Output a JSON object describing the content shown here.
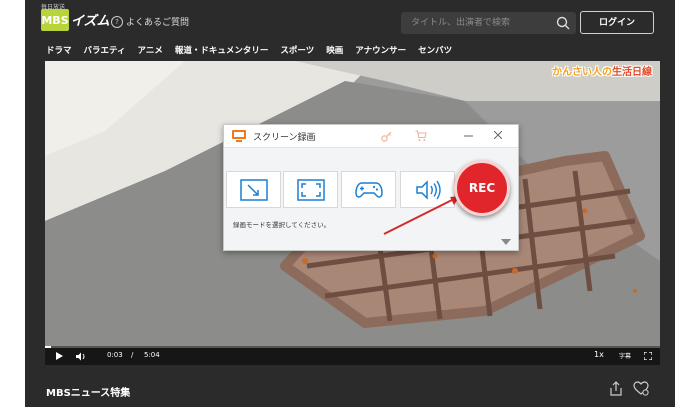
{
  "site": {
    "logo_small": "毎日放送",
    "logo_icon_text": "MBS",
    "logo_text": "イズム",
    "faq_label": "よくあるご質問",
    "search_placeholder": "タイトル、出演者で検索",
    "login_label": "ログイン"
  },
  "nav": [
    "ドラマ",
    "バラエティ",
    "アニメ",
    "報道・ドキュメンタリー",
    "スポーツ",
    "映画",
    "アナウンサー",
    "センバツ"
  ],
  "video": {
    "overlay_brand_pre": "かんさい人の",
    "overlay_brand_main": "生活日線",
    "current_time": "0:03",
    "separator": "/",
    "duration": "5:04",
    "progress": 0.01,
    "speed": "1x",
    "subtitle_label": "字幕"
  },
  "program_title": "MBSニュース特集",
  "dialog": {
    "title": "スクリーン録画",
    "hint": "録画モードを選択してください。",
    "modes": [
      "region-icon",
      "fullscreen-icon",
      "game-icon",
      "audio-icon"
    ],
    "rec_label": "REC"
  },
  "colors": {
    "accent": "#b7d43a",
    "rec": "#e0262a",
    "icon_blue": "#1a7fd4"
  }
}
